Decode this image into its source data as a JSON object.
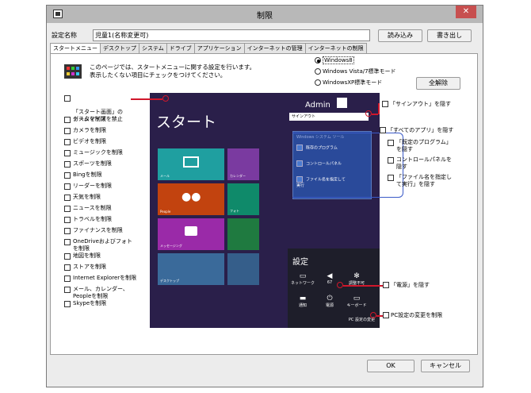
{
  "window": {
    "title": "制限",
    "close_label": "✕"
  },
  "header": {
    "setting_name_label": "設定名称",
    "setting_name_value": "児童1(名称変更可)",
    "load_button": "読み込み",
    "write_button": "書き出し"
  },
  "tabs": [
    "スタートメニュー",
    "デスクトップ",
    "システム",
    "ドライブ",
    "アプリケーション",
    "インターネットの管理",
    "インターネットの制限"
  ],
  "info": {
    "line1": "このページでは、スタートメニューに関する設定を行います。",
    "line2": "表示したくない項目にチェックをつけてください。"
  },
  "os_options": [
    "Windows8",
    "Windows Vista/7標準モード",
    "WindowsXP標準モード"
  ],
  "release_all_button": "全解除",
  "customize_start": "「スタート画面」の\nカスタマイズを禁止",
  "left_options": [
    "ゲームを制限",
    "カメラを制限",
    "ビデオを制限",
    "ミュージックを制限",
    "スポーツを制限",
    "Bingを制限",
    "リーダーを制限",
    "天気を制限",
    "ニュースを制限",
    "トラベルを制限",
    "ファイナンスを制限",
    "OneDriveおよびフォト\nを制限",
    "地図を制限",
    "ストアを制限",
    "Internet Explorerを制限",
    "メール、カレンダー、\nPeopleを制限",
    "Skypeを制限"
  ],
  "start_screen": {
    "title": "スタート",
    "user": "Admin",
    "signout": "サインアウト",
    "tile_labels": [
      "メール",
      "カレンダー",
      "People",
      "フォト",
      "メッセージング",
      "デスクトップ"
    ],
    "tools_header": "Windows システム ツール",
    "tools": [
      "既存のプログラム",
      "コントロールパネル",
      "ファイル名を指定して\n実行"
    ],
    "settings_title": "設定",
    "settings_items": [
      "ネットワーク",
      "67",
      "調整不可",
      "通知",
      "電源",
      "キーボード"
    ],
    "pc_settings": "PC 設定の変更"
  },
  "right_options": {
    "signout": "「サインアウト」を隠す",
    "all_apps": "「すべてのアプリ」を隠す",
    "default_programs": "「既定のプログラム」\nを隠す",
    "control_panel": "コントロールパネルを\n隠す",
    "run": "「ファイル名を指定し\nて実行」を隠す",
    "power": "「電源」を隠す",
    "pc_settings": "PC設定の変更を制限"
  },
  "footer": {
    "ok": "OK",
    "cancel": "キャンセル"
  }
}
